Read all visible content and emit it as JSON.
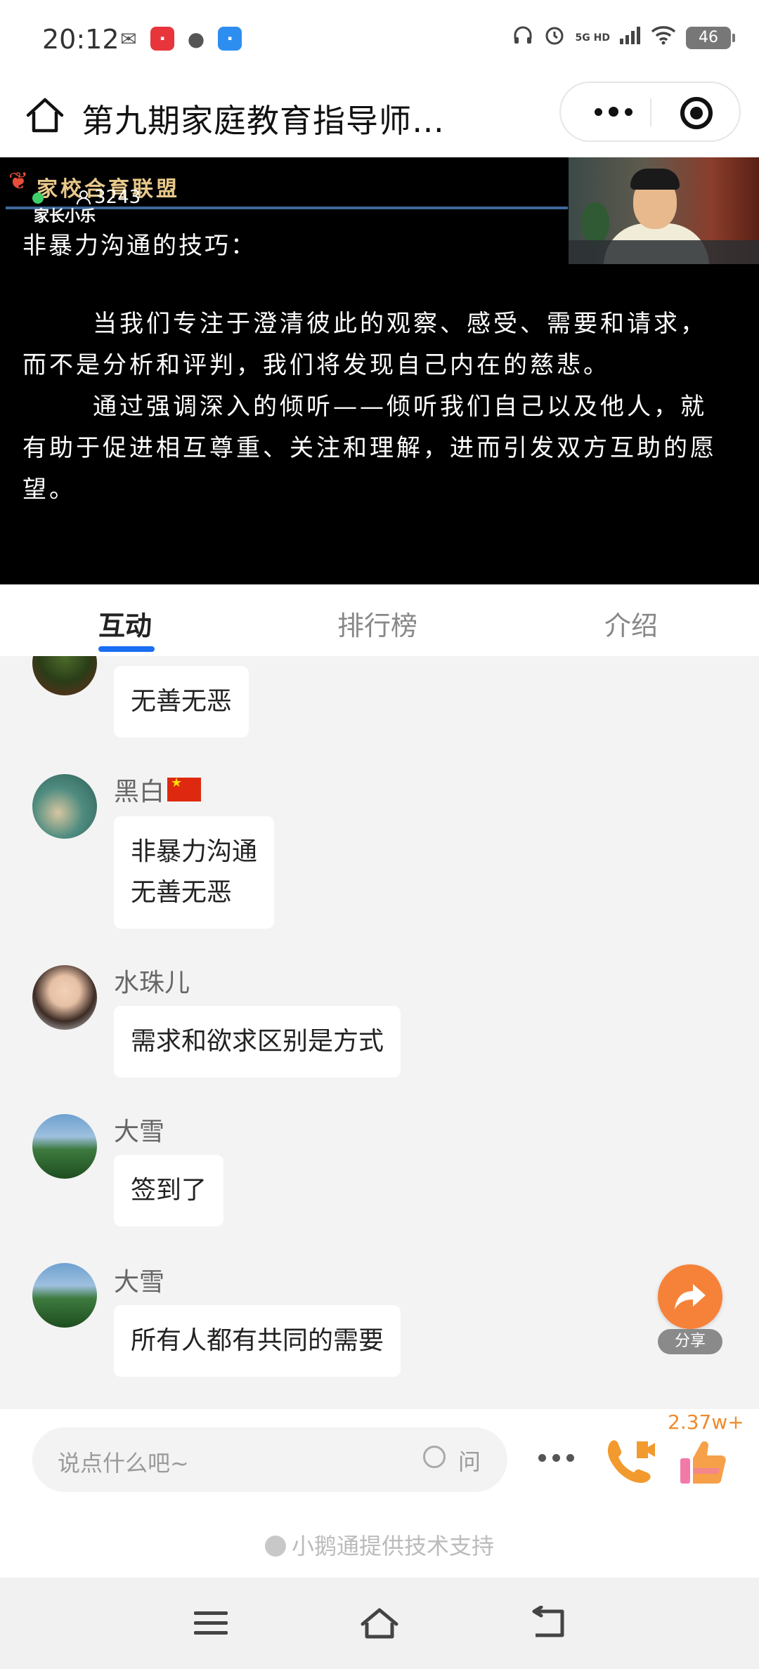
{
  "status_bar": {
    "time": "20:12",
    "network": "5G HD",
    "battery": "46",
    "icons_left": [
      "wechat-icon",
      "xiaohongshu-icon",
      "message-icon",
      "app-icon"
    ],
    "icons_right": [
      "headphones-icon",
      "alarm-icon",
      "signal-icon",
      "wifi-icon",
      "battery-icon"
    ]
  },
  "title_bar": {
    "title": "第九期家庭教育指导师…"
  },
  "video": {
    "brand": "家校合育联盟",
    "viewer_count": "3243",
    "slide_sub": "家长小乐",
    "slide_heading": "非暴力沟通的技巧：",
    "slide_paragraphs": [
      "当我们专注于澄清彼此的观察、感受、需要和请求，而不是分析和评判，我们将发现自己内在的慈悲。",
      "通过强调深入的倾听——倾听我们自己以及他人，就有助于促进相互尊重、关注和理解，进而引发双方互助的愿望。"
    ]
  },
  "tabs": [
    {
      "label": "互动",
      "active": true
    },
    {
      "label": "排行榜",
      "active": false
    },
    {
      "label": "介绍",
      "active": false
    }
  ],
  "messages": [
    {
      "user": "",
      "lines": [
        "无善无恶"
      ]
    },
    {
      "user": "黑白",
      "lines": [
        "非暴力沟通",
        "无善无恶"
      ]
    },
    {
      "user": "水珠儿",
      "lines": [
        "需求和欲求区别是方式"
      ]
    },
    {
      "user": "大雪",
      "lines": [
        "签到了"
      ]
    },
    {
      "user": "大雪",
      "lines": [
        "所有人都有共同的需要"
      ]
    }
  ],
  "share": {
    "label": "分享"
  },
  "input_bar": {
    "placeholder": "说点什么吧~",
    "ask_label": "问",
    "like_count": "2.37w+"
  },
  "powered_by": "小鹅通提供技术支持",
  "colors": {
    "accent_blue": "#1a6ef2",
    "share_orange": "#f6823a",
    "like_orange": "#f08a2a"
  }
}
